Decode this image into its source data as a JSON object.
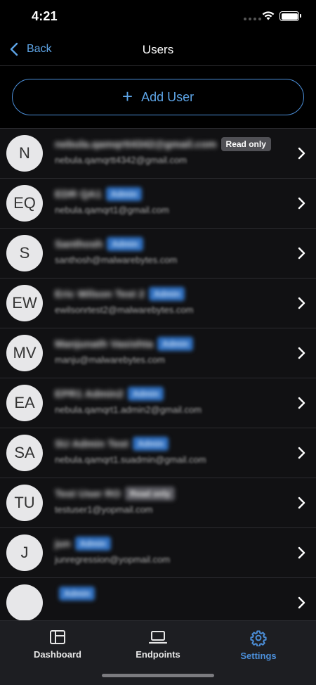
{
  "status_bar": {
    "time": "4:21"
  },
  "nav": {
    "back_label": "Back",
    "title": "Users"
  },
  "add_user": {
    "label": "Add User"
  },
  "users": [
    {
      "initials": "N",
      "name": "nebula.qamqrtt4342@gmail.com",
      "role": "Read only",
      "email": "nebula.qamqrtt4342@gmail.com"
    },
    {
      "initials": "EQ",
      "name": "EDR QA1",
      "role": "Admin",
      "email": "nebula.qamqrt1@gmail.com"
    },
    {
      "initials": "S",
      "name": "Santhosh",
      "role": "Admin",
      "email": "santhosh@malwarebytes.com"
    },
    {
      "initials": "EW",
      "name": "Eric Wilson Test 2",
      "role": "Admin",
      "email": "ewilsonrtest2@malwarebytes.com"
    },
    {
      "initials": "MV",
      "name": "Manjunath Vasishta",
      "role": "Admin",
      "email": "manju@malwarebytes.com"
    },
    {
      "initials": "EA",
      "name": "EPR1 Admin2",
      "role": "Admin",
      "email": "nebula.qamqrt1.admin2@gmail.com"
    },
    {
      "initials": "SA",
      "name": "SU Admin Test",
      "role": "Admin",
      "email": "nebula.qamqrt1.suadmin@gmail.com"
    },
    {
      "initials": "TU",
      "name": "Test User RO",
      "role": "Read only",
      "email": "testuser1@yopmail.com"
    },
    {
      "initials": "J",
      "name": "jun",
      "role": "Admin",
      "email": "junregression@yopmail.com"
    },
    {
      "initials": "",
      "name": "",
      "role": "Admin",
      "email": ""
    }
  ],
  "tabs": [
    {
      "label": "Dashboard",
      "icon": "dashboard-icon",
      "active": false
    },
    {
      "label": "Endpoints",
      "icon": "laptop-icon",
      "active": false
    },
    {
      "label": "Settings",
      "icon": "gear-icon",
      "active": true
    }
  ],
  "colors": {
    "accent": "#4b8ed8",
    "background": "#000000",
    "row_bg": "#111113",
    "tab_bar": "#1d1e22"
  }
}
